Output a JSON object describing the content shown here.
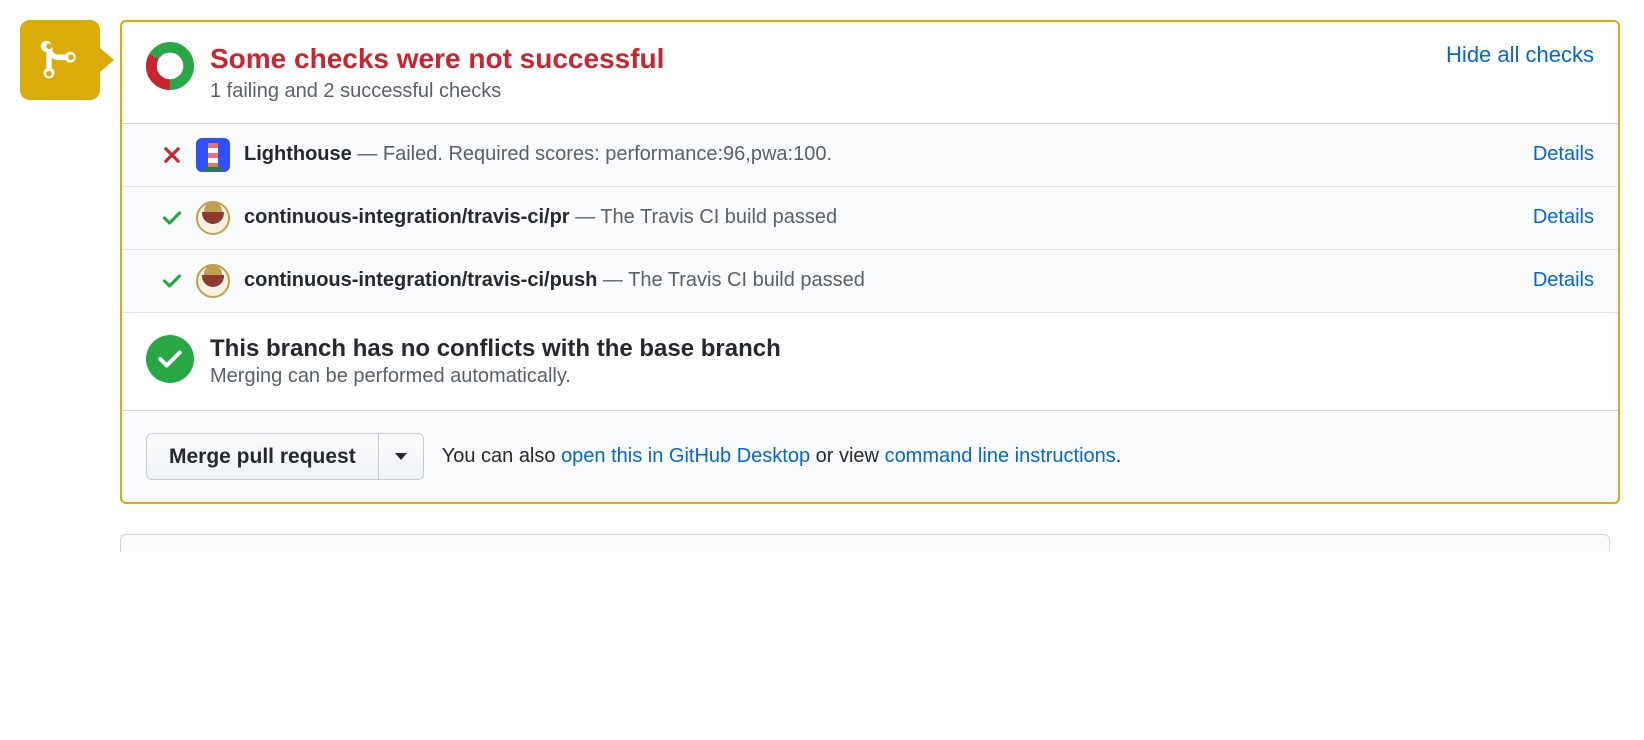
{
  "colors": {
    "warning": "#dbab09",
    "danger": "#cb2431",
    "success": "#28a745",
    "link": "#0366d6"
  },
  "header": {
    "title": "Some checks were not successful",
    "subtitle": "1 failing and 2 successful checks",
    "toggle": "Hide all checks"
  },
  "checks": [
    {
      "status": "fail",
      "avatar": "lighthouse-icon",
      "name": "Lighthouse",
      "message": " — Failed. Required scores: performance:96,pwa:100.",
      "action": "Details"
    },
    {
      "status": "pass",
      "avatar": "travis-icon",
      "name": "continuous-integration/travis-ci/pr",
      "message": " — The Travis CI build passed",
      "action": "Details"
    },
    {
      "status": "pass",
      "avatar": "travis-icon",
      "name": "continuous-integration/travis-ci/push",
      "message": " — The Travis CI build passed",
      "action": "Details"
    }
  ],
  "conflicts": {
    "title": "This branch has no conflicts with the base branch",
    "subtitle": "Merging can be performed automatically."
  },
  "footer": {
    "button": "Merge pull request",
    "text_pre": "You can also ",
    "link1": "open this in GitHub Desktop",
    "text_mid": " or view ",
    "link2": "command line instructions",
    "text_post": "."
  }
}
